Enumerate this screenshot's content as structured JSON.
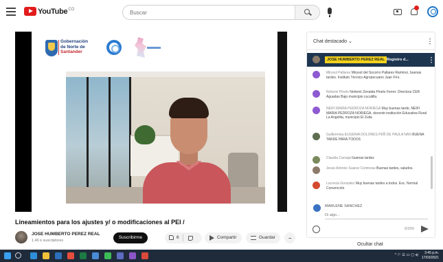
{
  "header": {
    "logo_text": "YouTube",
    "logo_sup": "CO",
    "search_placeholder": "Buscar"
  },
  "video": {
    "overlay_text": {
      "line1": "Gobernación",
      "line2": "de Norte de",
      "line3": "Santander"
    },
    "title": "Lineamientos para los ajustes y/ o modificaciones al PEI /",
    "channel_name": "JOSE HUMBERTO PEREZ REAL",
    "channel_subs": "1,46 k suscriptores",
    "subscribe_label": "Suscribirme",
    "like_count": "6",
    "share_label": "Compartir",
    "save_label": "Guardar",
    "more_label": "..."
  },
  "chat": {
    "header_title": "Chat destacado ⌄",
    "pinned": {
      "author": "JOSE HUMBERTO PEREZ REAL",
      "message": "Registro d..."
    },
    "messages": [
      {
        "author": "Mirysol Pallares",
        "text": "Mirysol del Socorro Pallares Ramírez, buenas tardes. Instituto Técnico Agropecuario Juan Frío.",
        "avatar_color": "#8e5ad1"
      },
      {
        "author": "Nohemí Pinelo",
        "text": "Nohemí Zenaida Pinelo Ferrer. Directora CER Aguadas Bajo municipio cucutilla.",
        "avatar_color": "#8e5ad1"
      },
      {
        "author": "NEIFI MARIA PEDROZA NORIEGA",
        "text": "Muy buenas tarde, NEIFI MARIA PEDROZA NORIEGA, docente institución Educativa Rural La Angelita, municipio El Zulia",
        "avatar_color": "#8e5ad1"
      },
      {
        "author": "Guillermina EUGENIA DOLORES PEÑ DE PAULA NAN",
        "text": "BUENA TARDE PARA TODOS",
        "avatar_color": "#5e6d4f"
      },
      {
        "author": "Claudia Carvajal",
        "text": "buenas tardes",
        "avatar_color": "#7a8a5c"
      },
      {
        "author": "Jesús Antonio Suarez Contreras",
        "text": "Buenas tardes, saludos.",
        "avatar_color": "#8d7b6a"
      },
      {
        "author": "Lucrecia Gonzalez",
        "text": "Muy buenas tardes a todos. Esc. Normal Convención",
        "avatar_color": "#d44a2f"
      }
    ],
    "input_name": "MARLENE SANCHEZ",
    "input_placeholder": "Di algo...",
    "char_count": "0/200",
    "hide_label": "Ocultar chat"
  },
  "taskbar": {
    "tray_text": "^ ⚐ ☰ ▭ ◻ ◂)",
    "clock_time": "3:45 p.m.",
    "clock_date": "17/03/2021"
  }
}
